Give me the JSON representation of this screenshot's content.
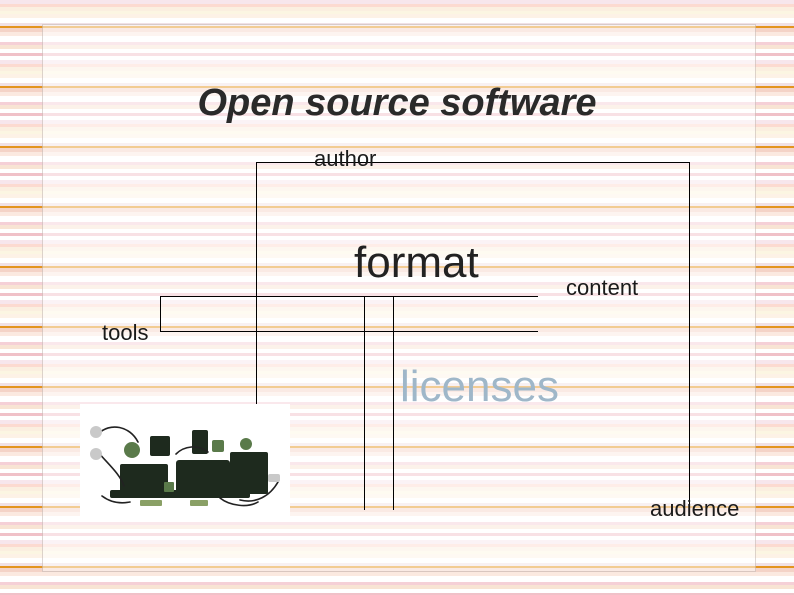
{
  "title": "Open source software",
  "labels": {
    "author": "author",
    "format": "format",
    "content": "content",
    "tools": "tools",
    "licenses": "licenses",
    "audience": "audience"
  }
}
